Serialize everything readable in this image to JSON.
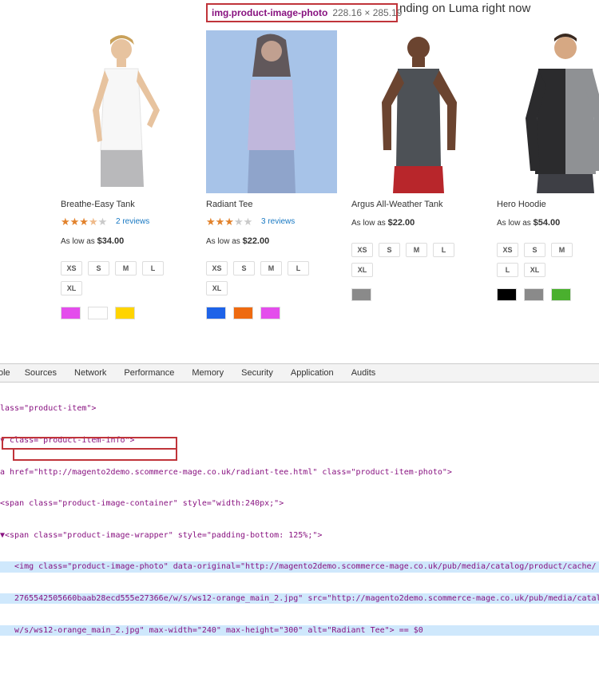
{
  "heading": "nding on Luma right now",
  "inspector": {
    "selector": "img.product-image-photo",
    "dimensions": "228.16 × 285.19"
  },
  "products": [
    {
      "name": "Breathe-Easy Tank",
      "rating": 3.5,
      "reviews": "2 reviews",
      "price_prefix": "As low as",
      "price": "$34.00",
      "sizes": [
        "XS",
        "S",
        "M",
        "L",
        "XL"
      ],
      "colors": [
        "#e44dec",
        "#ffffff",
        "#ffd400"
      ]
    },
    {
      "name": "Radiant Tee",
      "rating": 3,
      "reviews": "3 reviews",
      "price_prefix": "As low as",
      "price": "$22.00",
      "sizes": [
        "XS",
        "S",
        "M",
        "L",
        "XL"
      ],
      "colors": [
        "#1e63e8",
        "#ee6a10",
        "#e44dec"
      ]
    },
    {
      "name": "Argus All-Weather Tank",
      "price_prefix": "As low as",
      "price": "$22.00",
      "sizes": [
        "XS",
        "S",
        "M",
        "L",
        "XL"
      ],
      "colors": [
        "#8a8a8a"
      ]
    },
    {
      "name": "Hero Hoodie",
      "price_prefix": "As low as",
      "price": "$54.00",
      "sizes": [
        "XS",
        "S",
        "M",
        "L",
        "XL"
      ],
      "colors": [
        "#000000",
        "#8a8a8a",
        "#4ab02e"
      ]
    }
  ],
  "devtools": {
    "tabs": [
      "ole",
      "Sources",
      "Network",
      "Performance",
      "Memory",
      "Security",
      "Application",
      "Audits"
    ],
    "lines": [
      "lass=\"product-item\">",
      "v class=\"product-item-info\">",
      "a href=\"http://magento2demo.scommerce-mage.co.uk/radiant-tee.html\" class=\"product-item-photo\">",
      "<span class=\"product-image-container\" style=\"width:240px;\">",
      "▼<span class=\"product-image-wrapper\" style=\"padding-bottom: 125%;\">",
      "   <img class=\"product-image-photo\" data-original=\"http://magento2demo.scommerce-mage.co.uk/pub/media/catalog/product/cache/",
      "   2765542505660baab28ecd555e27366e/w/s/ws12-orange_main_2.jpg\" src=\"http://magento2demo.scommerce-mage.co.uk/pub/media/catalo",
      "   w/s/ws12-orange_main_2.jpg\" max-width=\"240\" max-height=\"300\" alt=\"Radiant Tee\"> == $0"
    ]
  }
}
